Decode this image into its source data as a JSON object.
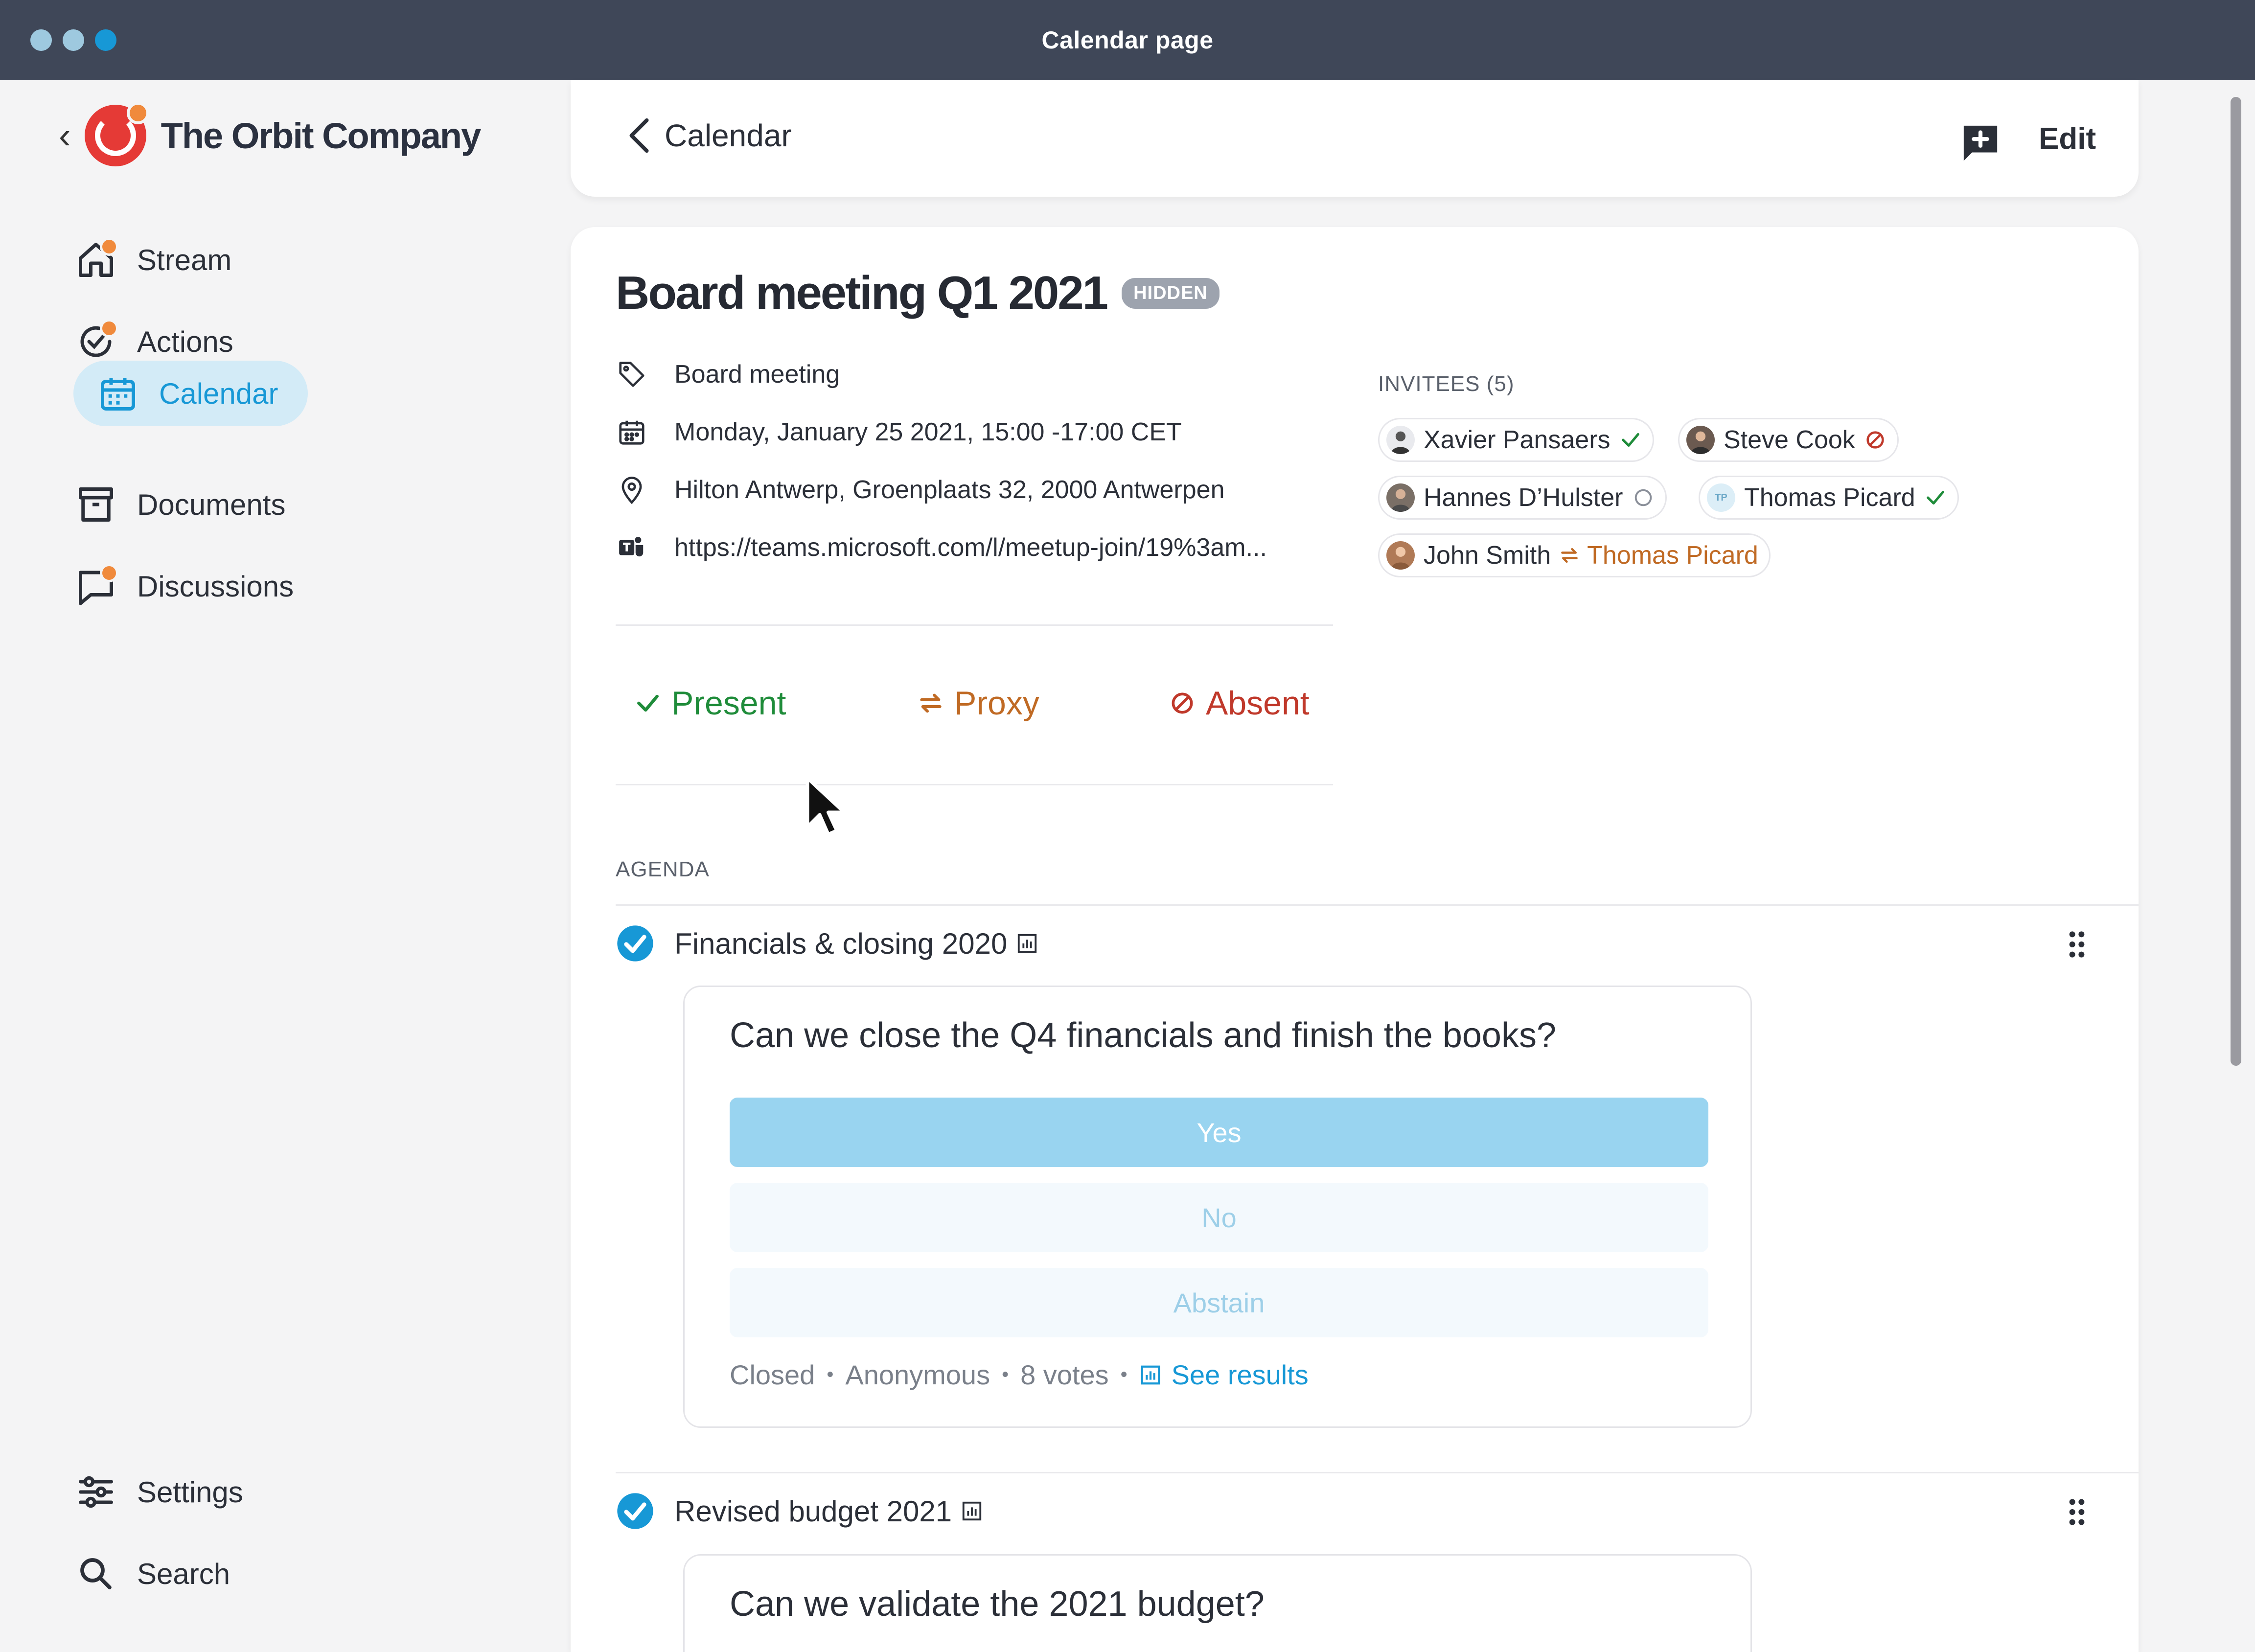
{
  "window": {
    "title": "Calendar page",
    "traffic": [
      "#9ec9df",
      "#9ec9df",
      "#1798d6"
    ]
  },
  "brand": {
    "name": "The Orbit Company"
  },
  "sidebar": {
    "items": [
      {
        "label": "Stream",
        "icon": "home-icon",
        "dot": true
      },
      {
        "label": "Actions",
        "icon": "check-circle-icon",
        "dot": true
      },
      {
        "label": "Calendar",
        "icon": "calendar-icon",
        "dot": false,
        "active": true
      },
      {
        "label": "Documents",
        "icon": "archive-icon",
        "dot": false
      },
      {
        "label": "Discussions",
        "icon": "chat-icon",
        "dot": true
      }
    ],
    "bottom": [
      {
        "label": "Settings",
        "icon": "sliders-icon"
      },
      {
        "label": "Search",
        "icon": "search-icon"
      }
    ]
  },
  "header": {
    "back_label": "Calendar",
    "edit_label": "Edit"
  },
  "meeting": {
    "title": "Board meeting Q1 2021",
    "badge": "HIDDEN",
    "category": "Board meeting",
    "datetime": "Monday, January 25 2021, 15:00 -17:00 CET",
    "location": "Hilton Antwerp, Groenplaats 32, 2000 Antwerpen",
    "link": "https://teams.microsoft.com/l/meetup-join/19%3am...",
    "invitees_label": "INVITEES (5)",
    "invitees": [
      {
        "name": "Xavier Pansaers",
        "status": "present"
      },
      {
        "name": "Steve Cook",
        "status": "absent"
      },
      {
        "name": "Hannes D’Hulster",
        "status": "pending"
      },
      {
        "name": "Thomas Picard",
        "status": "present",
        "initials": "TP"
      },
      {
        "name": "John Smith",
        "status": "proxy",
        "proxy_name": "Thomas Picard"
      }
    ]
  },
  "rsvp": {
    "present": "Present",
    "proxy": "Proxy",
    "absent": "Absent"
  },
  "colors": {
    "present": "#1f8c3a",
    "proxy": "#c06a24",
    "absent": "#c0392b",
    "accent": "#1798d6"
  },
  "agenda": {
    "label": "AGENDA",
    "items": [
      {
        "title": "Financials & closing 2020",
        "question": "Can we close the Q4 financials and finish the books?",
        "options": [
          "Yes",
          "No",
          "Abstain"
        ],
        "status": "Closed",
        "anonymity": "Anonymous",
        "votes": "8 votes",
        "results_label": "See results"
      },
      {
        "title": "Revised budget 2021",
        "question": "Can we validate the 2021 budget?"
      }
    ]
  }
}
